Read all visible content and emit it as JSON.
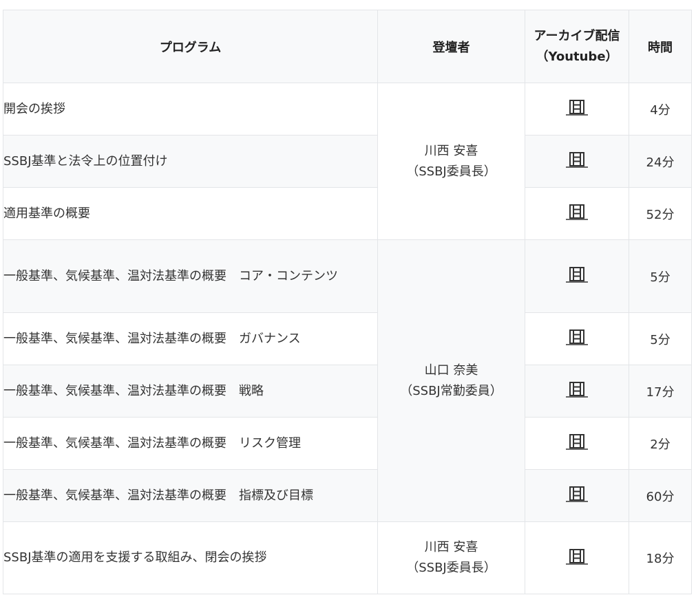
{
  "headers": {
    "program": "プログラム",
    "speaker": "登壇者",
    "archive_line1": "アーカイブ配信",
    "archive_line2": "（Youtube）",
    "time": "時間"
  },
  "rows": [
    {
      "program": "開会の挨拶",
      "time": "4分",
      "icon": "film-icon"
    },
    {
      "program": "SSBJ基準と法令上の位置付け",
      "time": "24分",
      "icon": "film-icon"
    },
    {
      "program": "適用基準の概要",
      "time": "52分",
      "icon": "film-icon"
    },
    {
      "program": "一般基準、気候基準、温対法基準の概要　コア・コンテンツ",
      "time": "5分",
      "icon": "film-icon"
    },
    {
      "program": "一般基準、気候基準、温対法基準の概要　ガバナンス",
      "time": "5分",
      "icon": "film-icon"
    },
    {
      "program": "一般基準、気候基準、温対法基準の概要　戦略",
      "time": "17分",
      "icon": "film-icon"
    },
    {
      "program": "一般基準、気候基準、温対法基準の概要　リスク管理",
      "time": "2分",
      "icon": "film-icon"
    },
    {
      "program": "一般基準、気候基準、温対法基準の概要　指標及び目標",
      "time": "60分",
      "icon": "film-icon"
    },
    {
      "program": "SSBJ基準の適用を支援する取組み、閉会の挨拶",
      "time": "18分",
      "icon": "film-icon"
    }
  ],
  "speakers": [
    {
      "name": "川西 安喜",
      "title": "（SSBJ委員長）"
    },
    {
      "name": "山口 奈美",
      "title": "（SSBJ常勤委員）"
    },
    {
      "name": "川西 安喜",
      "title": "（SSBJ委員長）"
    }
  ],
  "colors": {
    "border": "#e3e5e8",
    "stripe": "#f8f9fa",
    "text": "#333333",
    "icon": "#333333"
  }
}
